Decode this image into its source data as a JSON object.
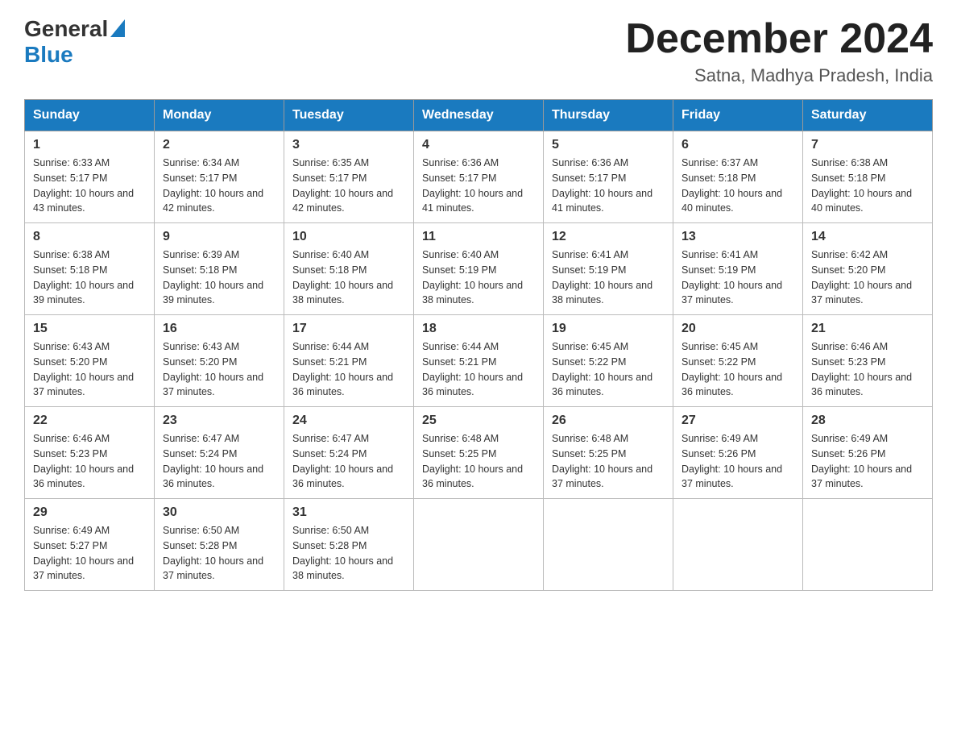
{
  "header": {
    "logo_general": "General",
    "logo_blue": "Blue",
    "month_title": "December 2024",
    "subtitle": "Satna, Madhya Pradesh, India"
  },
  "days_of_week": [
    "Sunday",
    "Monday",
    "Tuesday",
    "Wednesday",
    "Thursday",
    "Friday",
    "Saturday"
  ],
  "weeks": [
    [
      {
        "day": "1",
        "sunrise": "6:33 AM",
        "sunset": "5:17 PM",
        "daylight": "10 hours and 43 minutes."
      },
      {
        "day": "2",
        "sunrise": "6:34 AM",
        "sunset": "5:17 PM",
        "daylight": "10 hours and 42 minutes."
      },
      {
        "day": "3",
        "sunrise": "6:35 AM",
        "sunset": "5:17 PM",
        "daylight": "10 hours and 42 minutes."
      },
      {
        "day": "4",
        "sunrise": "6:36 AM",
        "sunset": "5:17 PM",
        "daylight": "10 hours and 41 minutes."
      },
      {
        "day": "5",
        "sunrise": "6:36 AM",
        "sunset": "5:17 PM",
        "daylight": "10 hours and 41 minutes."
      },
      {
        "day": "6",
        "sunrise": "6:37 AM",
        "sunset": "5:18 PM",
        "daylight": "10 hours and 40 minutes."
      },
      {
        "day": "7",
        "sunrise": "6:38 AM",
        "sunset": "5:18 PM",
        "daylight": "10 hours and 40 minutes."
      }
    ],
    [
      {
        "day": "8",
        "sunrise": "6:38 AM",
        "sunset": "5:18 PM",
        "daylight": "10 hours and 39 minutes."
      },
      {
        "day": "9",
        "sunrise": "6:39 AM",
        "sunset": "5:18 PM",
        "daylight": "10 hours and 39 minutes."
      },
      {
        "day": "10",
        "sunrise": "6:40 AM",
        "sunset": "5:18 PM",
        "daylight": "10 hours and 38 minutes."
      },
      {
        "day": "11",
        "sunrise": "6:40 AM",
        "sunset": "5:19 PM",
        "daylight": "10 hours and 38 minutes."
      },
      {
        "day": "12",
        "sunrise": "6:41 AM",
        "sunset": "5:19 PM",
        "daylight": "10 hours and 38 minutes."
      },
      {
        "day": "13",
        "sunrise": "6:41 AM",
        "sunset": "5:19 PM",
        "daylight": "10 hours and 37 minutes."
      },
      {
        "day": "14",
        "sunrise": "6:42 AM",
        "sunset": "5:20 PM",
        "daylight": "10 hours and 37 minutes."
      }
    ],
    [
      {
        "day": "15",
        "sunrise": "6:43 AM",
        "sunset": "5:20 PM",
        "daylight": "10 hours and 37 minutes."
      },
      {
        "day": "16",
        "sunrise": "6:43 AM",
        "sunset": "5:20 PM",
        "daylight": "10 hours and 37 minutes."
      },
      {
        "day": "17",
        "sunrise": "6:44 AM",
        "sunset": "5:21 PM",
        "daylight": "10 hours and 36 minutes."
      },
      {
        "day": "18",
        "sunrise": "6:44 AM",
        "sunset": "5:21 PM",
        "daylight": "10 hours and 36 minutes."
      },
      {
        "day": "19",
        "sunrise": "6:45 AM",
        "sunset": "5:22 PM",
        "daylight": "10 hours and 36 minutes."
      },
      {
        "day": "20",
        "sunrise": "6:45 AM",
        "sunset": "5:22 PM",
        "daylight": "10 hours and 36 minutes."
      },
      {
        "day": "21",
        "sunrise": "6:46 AM",
        "sunset": "5:23 PM",
        "daylight": "10 hours and 36 minutes."
      }
    ],
    [
      {
        "day": "22",
        "sunrise": "6:46 AM",
        "sunset": "5:23 PM",
        "daylight": "10 hours and 36 minutes."
      },
      {
        "day": "23",
        "sunrise": "6:47 AM",
        "sunset": "5:24 PM",
        "daylight": "10 hours and 36 minutes."
      },
      {
        "day": "24",
        "sunrise": "6:47 AM",
        "sunset": "5:24 PM",
        "daylight": "10 hours and 36 minutes."
      },
      {
        "day": "25",
        "sunrise": "6:48 AM",
        "sunset": "5:25 PM",
        "daylight": "10 hours and 36 minutes."
      },
      {
        "day": "26",
        "sunrise": "6:48 AM",
        "sunset": "5:25 PM",
        "daylight": "10 hours and 37 minutes."
      },
      {
        "day": "27",
        "sunrise": "6:49 AM",
        "sunset": "5:26 PM",
        "daylight": "10 hours and 37 minutes."
      },
      {
        "day": "28",
        "sunrise": "6:49 AM",
        "sunset": "5:26 PM",
        "daylight": "10 hours and 37 minutes."
      }
    ],
    [
      {
        "day": "29",
        "sunrise": "6:49 AM",
        "sunset": "5:27 PM",
        "daylight": "10 hours and 37 minutes."
      },
      {
        "day": "30",
        "sunrise": "6:50 AM",
        "sunset": "5:28 PM",
        "daylight": "10 hours and 37 minutes."
      },
      {
        "day": "31",
        "sunrise": "6:50 AM",
        "sunset": "5:28 PM",
        "daylight": "10 hours and 38 minutes."
      },
      null,
      null,
      null,
      null
    ]
  ],
  "labels": {
    "sunrise": "Sunrise:",
    "sunset": "Sunset:",
    "daylight": "Daylight:"
  }
}
